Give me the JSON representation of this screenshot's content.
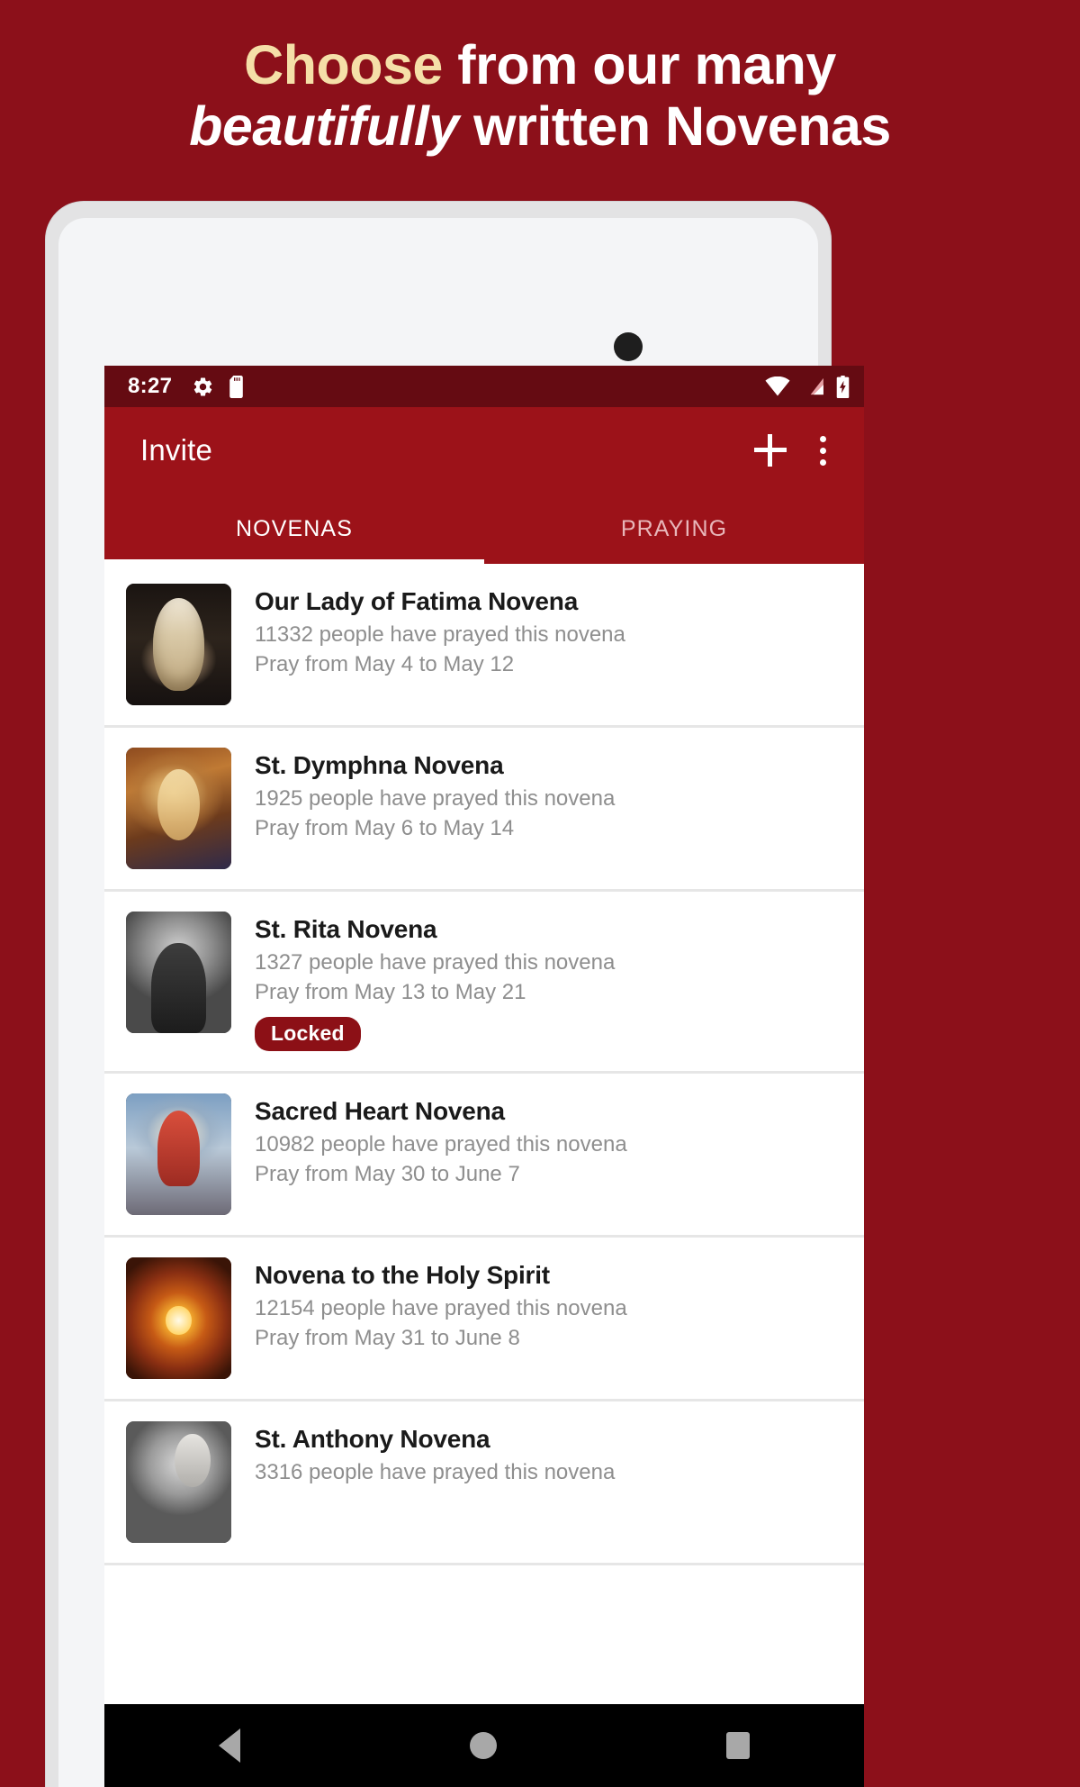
{
  "headline": {
    "line1_accent": "Choose",
    "line1_rest": " from our many",
    "line2_italic": "beautifully",
    "line2_rest": " written Novenas"
  },
  "colors": {
    "brand_red": "#8C101A",
    "appbar_red": "#9C1219",
    "statusbar_red": "#650B12",
    "accent_cream": "#F5DFA8",
    "badge_red": "#8C1016"
  },
  "status_bar": {
    "time": "8:27",
    "left_icons": [
      "gear-icon",
      "sd-card-icon"
    ],
    "right_icons": [
      "wifi-icon",
      "cellular-signal-icon",
      "battery-charging-icon"
    ]
  },
  "app_bar": {
    "title": "Invite",
    "actions": [
      "add-icon",
      "overflow-menu-icon"
    ]
  },
  "tabs": [
    {
      "label": "NOVENAS",
      "active": true
    },
    {
      "label": "PRAYING",
      "active": false
    }
  ],
  "novenas": [
    {
      "title": "Our Lady of Fatima Novena",
      "prayed": "11332 people have prayed this novena",
      "dates": "Pray from May 4 to May 12",
      "badge": null,
      "art": "art-fatima"
    },
    {
      "title": "St. Dymphna Novena",
      "prayed": "1925 people have prayed this novena",
      "dates": "Pray from May 6 to May 14",
      "badge": null,
      "art": "art-dymphna"
    },
    {
      "title": "St. Rita Novena",
      "prayed": "1327 people have prayed this novena",
      "dates": "Pray from May 13 to May 21",
      "badge": "Locked",
      "art": "art-rita"
    },
    {
      "title": "Sacred Heart Novena",
      "prayed": "10982 people have prayed this novena",
      "dates": "Pray from May 30 to June 7",
      "badge": null,
      "art": "art-sacred"
    },
    {
      "title": "Novena to the Holy Spirit",
      "prayed": "12154 people have prayed this novena",
      "dates": "Pray from May 31 to June 8",
      "badge": null,
      "art": "art-spirit"
    },
    {
      "title": "St. Anthony Novena",
      "prayed": "3316 people have prayed this novena",
      "dates": "",
      "badge": null,
      "art": "art-anthony"
    }
  ],
  "nav_bar": {
    "items": [
      "back-icon",
      "home-icon",
      "recents-icon"
    ]
  }
}
